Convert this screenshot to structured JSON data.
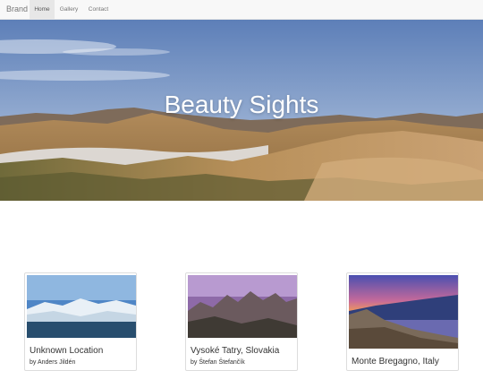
{
  "navbar": {
    "brand": "Brand",
    "items": [
      {
        "label": "Home",
        "active": true
      },
      {
        "label": "Gallery",
        "active": false
      },
      {
        "label": "Contact",
        "active": false
      }
    ]
  },
  "hero": {
    "title": "Beauty Sights"
  },
  "cards": [
    {
      "title": "Unknown Location",
      "author": "by Anders Jildén"
    },
    {
      "title": "Vysoké Tatry, Slovakia",
      "author": "by Štefan Štefančík"
    },
    {
      "title": "Monte Bregagno, Italy",
      "author": ""
    }
  ],
  "colors": {
    "navbar_bg": "#f8f8f8",
    "active_tab_bg": "#e7e7e7",
    "text": "#333333"
  }
}
